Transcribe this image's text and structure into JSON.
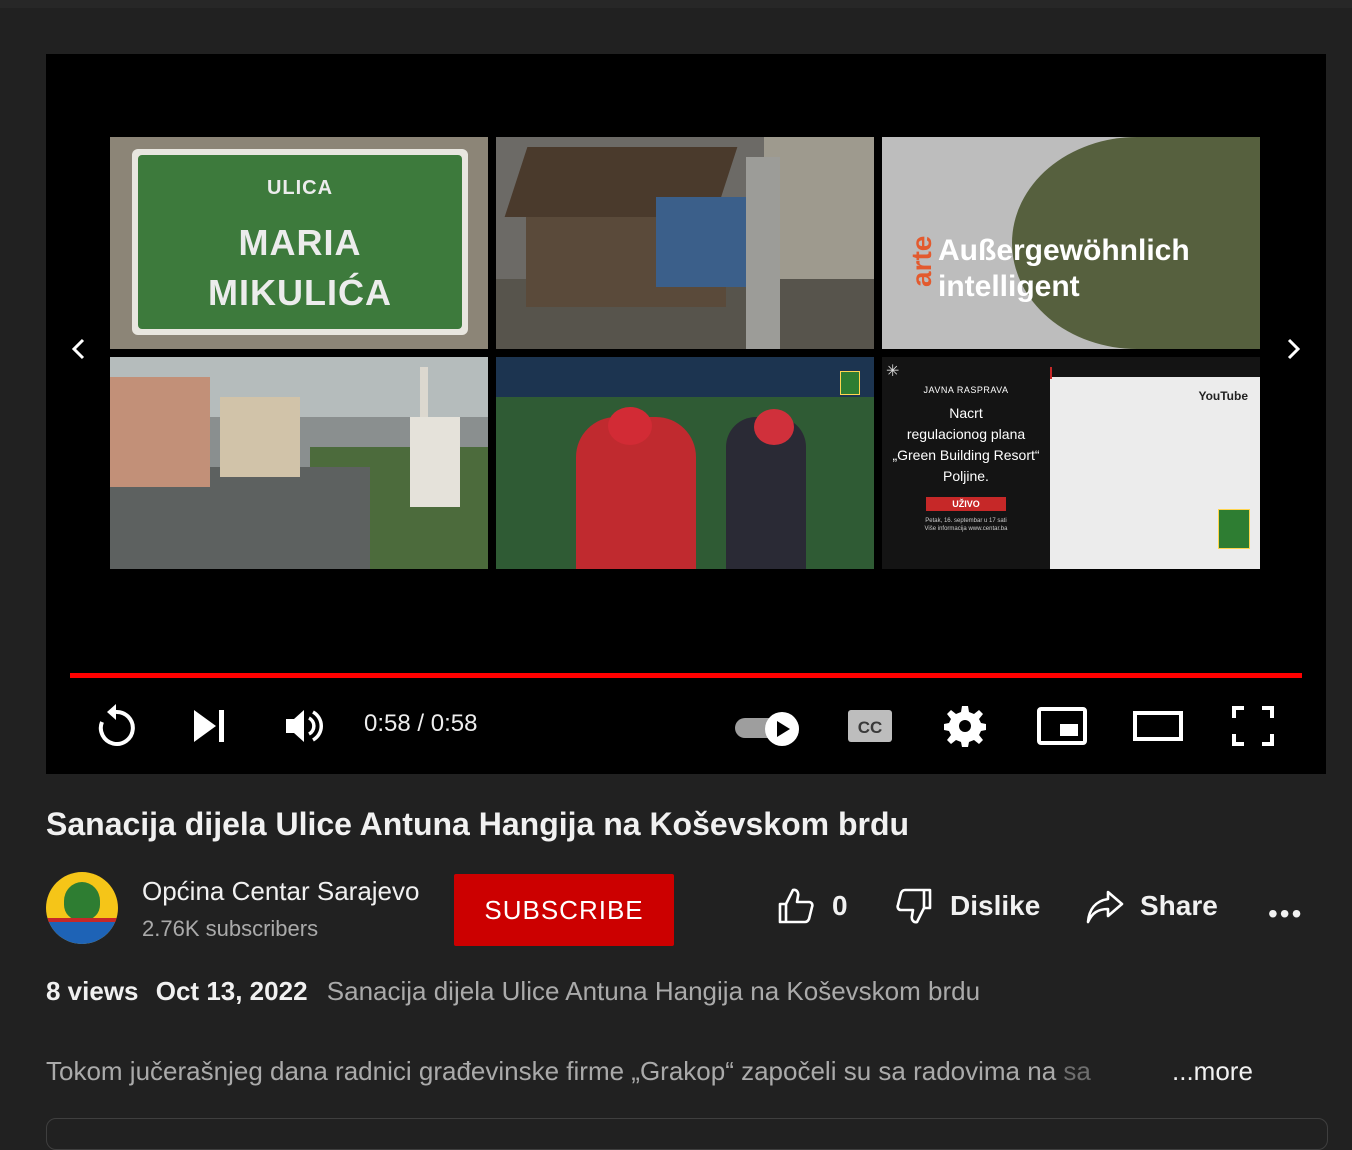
{
  "player": {
    "thumbnails": [
      {
        "sign_small": "ULICA",
        "sign_line1": "MARIA",
        "sign_line2": "MIKULIĆA"
      },
      {},
      {
        "brand": "arte",
        "text_line1": "Außergewöhnlich",
        "text_line2": "intelligent"
      },
      {},
      {},
      {
        "small": "JAVNA RASPRAVA",
        "title_line1": "Nacrt",
        "title_line2": "regulacionog plana",
        "title_line3": "„Green Building Resort“",
        "title_line4": "Poljine.",
        "live": "UŽIVO",
        "foot1": "Petak, 16. septembar u 17 sati",
        "foot2": "Više informacija www.centar.ba",
        "yt": "YouTube"
      }
    ],
    "progress_percent": 100,
    "time_display": "0:58 / 0:58",
    "autoplay_on": true
  },
  "video": {
    "title": "Sanacija dijela Ulice Antuna Hangija na Koševskom brdu"
  },
  "channel": {
    "name": "Općina Centar Sarajevo",
    "subscribers": "2.76K subscribers",
    "subscribe_label": "SUBSCRIBE"
  },
  "actions": {
    "likes": "0",
    "dislike_label": "Dislike",
    "share_label": "Share",
    "more_label": "•••"
  },
  "meta": {
    "views": "8 views",
    "date": "Oct 13, 2022",
    "tag": "Sanacija dijela Ulice Antuna Hangija na Koševskom brdu"
  },
  "description": {
    "text": "Tokom jučerašnjeg dana radnici građevinske firme „Grakop“ započeli su sa radovima na ",
    "faded": "sa",
    "more_label": "...more"
  },
  "colors": {
    "background": "#212121",
    "accent": "#ff0000",
    "subscribe": "#cc0000"
  }
}
